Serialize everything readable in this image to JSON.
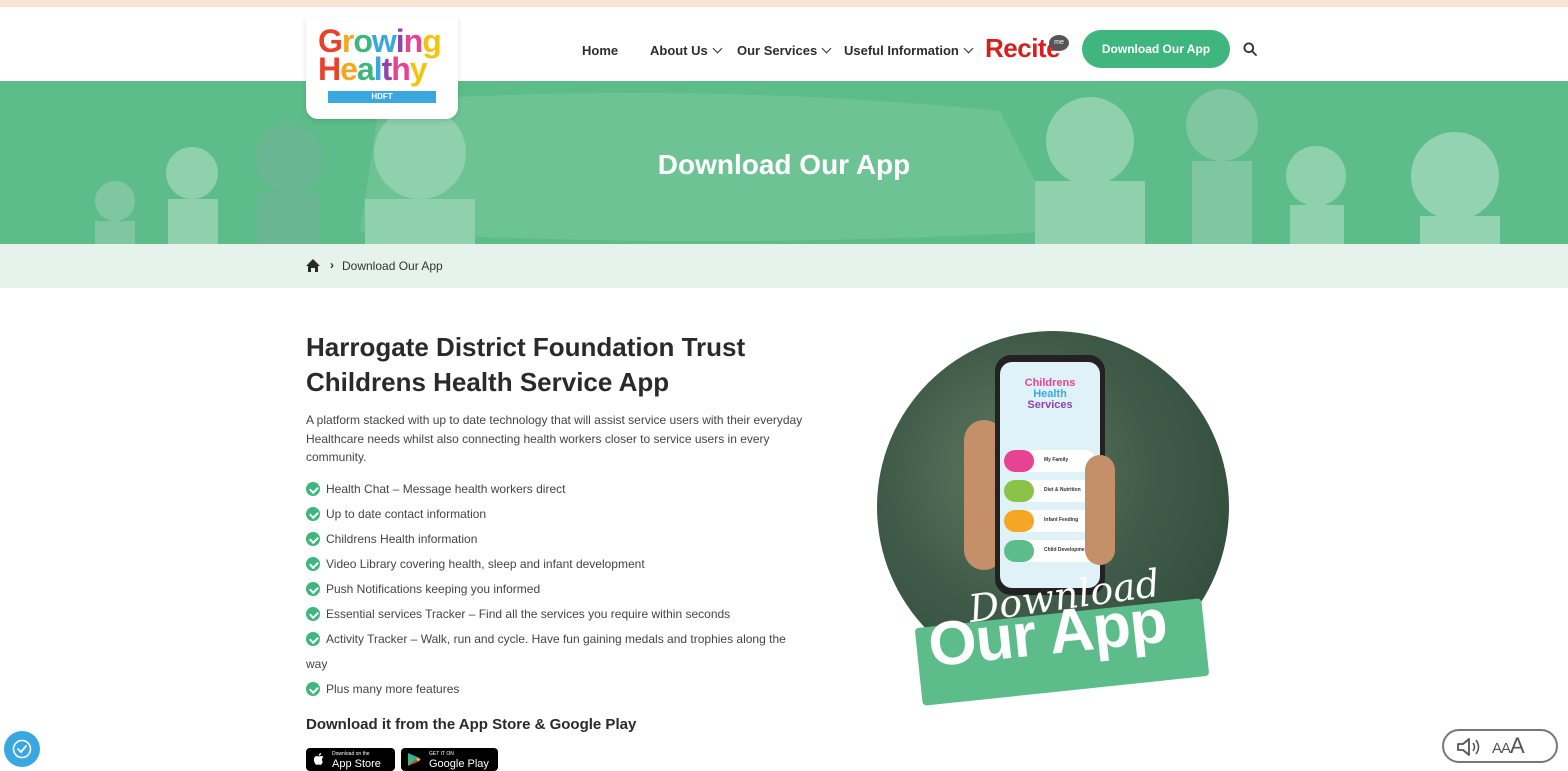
{
  "logo": {
    "line1": [
      "G",
      "r",
      "o",
      "w",
      "i",
      "n",
      "g"
    ],
    "line2": [
      "H",
      "e",
      "a",
      "l",
      "t",
      "h",
      "y"
    ],
    "badge": "HDFT",
    "colors": [
      "#e8412c",
      "#f5a623",
      "#3eb67e",
      "#3aa7e0",
      "#8e44ad",
      "#e84393",
      "#f1c40f"
    ]
  },
  "nav": {
    "items": [
      {
        "label": "Home",
        "dropdown": false
      },
      {
        "label": "About Us",
        "dropdown": true
      },
      {
        "label": "Our Services",
        "dropdown": true
      },
      {
        "label": "Useful Information",
        "dropdown": true
      }
    ],
    "recite_label": "Recite",
    "recite_badge": "me",
    "cta_label": "Download Our App",
    "search_icon": "search-icon"
  },
  "hero": {
    "title": "Download Our App"
  },
  "breadcrumb": {
    "home_icon": "home-icon",
    "current": "Download Our App"
  },
  "main": {
    "title": "Harrogate District Foundation Trust Childrens Health Service App",
    "intro": "A platform stacked with up to date technology that will assist service users with their everyday Healthcare needs whilst also connecting health workers closer to service users in every community.",
    "features": [
      "Health Chat – Message health workers direct",
      "Up to date contact information",
      "Childrens Health information",
      "Video Library covering health, sleep and infant development",
      "Push Notifications keeping you informed",
      "Essential services Tracker – Find all the services you require within seconds"
    ],
    "feature_wrap": {
      "line1": "Activity Tracker – Walk, run and cycle. Have fun gaining medals and trophies along the",
      "line2": "way"
    },
    "feature_last": "Plus many more features",
    "download_heading": "Download it from the App Store & Google Play",
    "app_store": {
      "small": "Download on the",
      "big": "App Store"
    },
    "google_play": {
      "small": "GET IT ON",
      "big": "Google Play"
    }
  },
  "promo": {
    "app_title_lines": [
      "Childrens",
      "Health",
      "Services"
    ],
    "menu": [
      {
        "label": "My Family",
        "color": "#e84393"
      },
      {
        "label": "Diet & Nutrition",
        "color": "#8bc34a"
      },
      {
        "label": "Infant Feeding",
        "color": "#f5a623"
      },
      {
        "label": "Child Development",
        "color": "#5dbd8a"
      }
    ],
    "script_text": "Download",
    "big_text": "Our App"
  },
  "accessibility": {
    "left_icon": "accessibility-icon",
    "right_text_small": "AA",
    "right_text_big": "A"
  },
  "colors": {
    "brand_green": "#3eb67e",
    "hero_green": "#5dbd8a",
    "breadcrumb_bg": "#e6f3ec",
    "top_strip": "#f7e3cf",
    "recite_red": "#d81e1e"
  }
}
